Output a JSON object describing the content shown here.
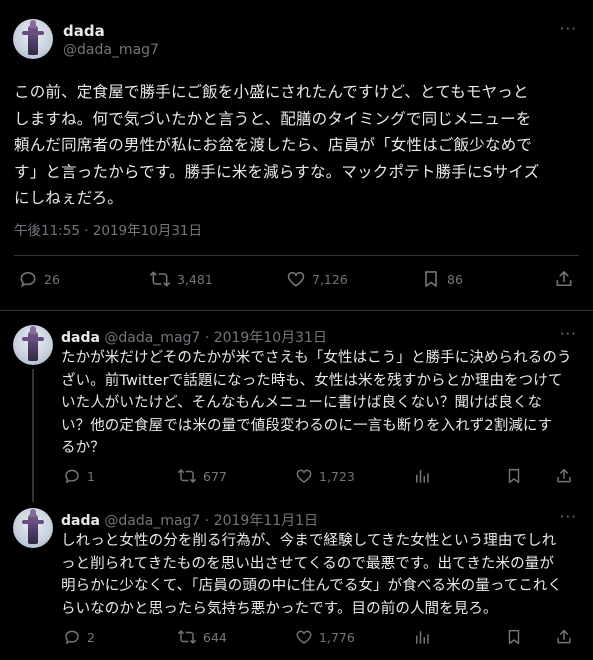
{
  "main_tweet": {
    "display_name": "dada",
    "handle": "@dada_mag7",
    "more": "···",
    "text": "この前、定食屋で勝手にご飯を小盛にされたんですけど、とてもモヤっと\nしますね。何で気づいたかと言うと、配膳のタイミングで同じメニューを\n頼んだ同席者の男性が私にお盆を渡したら、店員が「女性はご飯少なめで\nす」と言ったからです。勝手に米を減らすな。マックポテト勝手にSサイズ\nにしねぇだろ。",
    "timestamp": "午後11:55 · 2019年10月31日",
    "replies": "26",
    "retweets": "3,481",
    "likes": "7,126",
    "bookmarks": "86"
  },
  "replies": [
    {
      "display_name": "dada",
      "handle": "@dada_mag7",
      "date": "· 2019年10月31日",
      "more": "···",
      "text": "たかが米だけどそのたかが米でさえも「女性はこう」と勝手に決められるのう\nざい。前Twitterで話題になった時も、女性は米を残すからとか理由をつけて\nいた人がいたけど、そんなもんメニューに書けば良くない？聞けば良くな\nい？他の定食屋では米の量で値段変わるのに一言も断りを入れず2割減にす\nるか？",
      "replies": "1",
      "retweets": "677",
      "likes": "1,723"
    },
    {
      "display_name": "dada",
      "handle": "@dada_mag7",
      "date": "· 2019年11月1日",
      "more": "···",
      "text": "しれっと女性の分を削る行為が、今まで経験してきた女性という理由でしれ\nっと削られてきたものを思い出させてくるので最悪です。出てきた米の量が\n明らかに少なくて、「店員の頭の中に住んでる女」が食べる米の量ってこれく\nらいなのかと思ったら気持ち悪かったです。目の前の人間を見ろ。",
      "replies": "2",
      "retweets": "644",
      "likes": "1,776"
    }
  ],
  "icons": [
    "reply-icon",
    "retweet-icon",
    "like-icon",
    "bookmark-icon",
    "share-icon",
    "views-icon",
    "more-icon"
  ],
  "colors": {
    "background": "#000000",
    "text": "#e7e9ea",
    "secondary": "#71767b",
    "divider": "#2f3336"
  }
}
